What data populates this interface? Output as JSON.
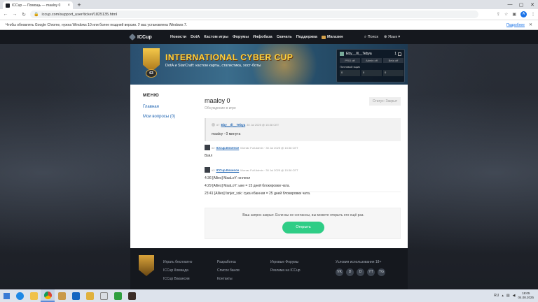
{
  "browser": {
    "tab_title": "ICCup — Помощь — maaloy 0",
    "url": "iccup.com/support_user/ticket/1825135.html",
    "avatar_letter": "A",
    "info_message": "Чтобы обновлять Google Chrome, нужна Windows 10 или более поздней версии. У вас установлена Windows 7.",
    "info_more": "Подробнее"
  },
  "site": {
    "logo": "ICCup",
    "menu": [
      "Новости",
      "DotA",
      "Кастом игры",
      "Форумы",
      "Инфобаза",
      "Скачать",
      "Поддержка",
      "Магазин"
    ],
    "search_label": "Поиск",
    "lang_label": "Язык",
    "banner": {
      "level": "63",
      "title": "INTERNATIONAL CYBER CUP",
      "subtitle": "DotA и StarCraft: кастом карты, статистика, хост-боты"
    },
    "user_panel": {
      "name": "Eby__Ill__Tebya",
      "count": "1",
      "tags": [
        "PRO off",
        "Admin off",
        "Beta off"
      ],
      "mail_label": "Почтовый ящик",
      "counts": [
        "0",
        "0",
        "0"
      ]
    }
  },
  "sidebar": {
    "title": "МЕНЮ",
    "items": [
      "Главная",
      "Мои вопросы (0)"
    ]
  },
  "ticket": {
    "title": "maaloy 0",
    "subtitle": "Обсуждение в игре",
    "status": "Статус: Закрыт",
    "question": {
      "num": "#7",
      "author": "Eby__Ill__Tebya",
      "date": "30 Jul 2025 @ 15:38 CET",
      "text": "maaloy - 0 минута"
    },
    "answers": [
      {
        "num": "#2",
        "author": "ICCup.Essence",
        "meta": "Мотив: Full Admin · 30 Jul 2025 @ 15:38 CET",
        "lines": [
          "Взял"
        ]
      },
      {
        "num": "#3",
        "author": "ICCup.Essence",
        "meta": "Мотив: Full Admin · 30 Jul 2025 @ 15:38 CET",
        "lines": [
          "4:36 [Allies] MaaLoY: онлеол",
          "4:29 [Allies] MaaLoY: ыке = 15 дней блокировки чата.",
          "23:41 [Allies] fanjer_ssk: сука ебанная = 25 дней блокировки чата."
        ]
      }
    ],
    "closed_text": "Ваш запрос закрыт. Если вы не согласны, вы можете открыть его ещё раз.",
    "open_button": "Открыть"
  },
  "footer": {
    "col1": [
      "Играть бесплатно",
      "ICCup Команда",
      "ICCup Вакансии"
    ],
    "col2": [
      "Разработка",
      "Список банов",
      "Контакты"
    ],
    "col3": [
      "Игровые Форумы",
      "Реклама на ICCup"
    ],
    "social_title": "Условия использования 18+",
    "social": [
      "VK",
      "D",
      "D",
      "YT",
      "TG"
    ]
  },
  "taskbar": {
    "lang": "RU",
    "time": "18:05",
    "date": "04.08.2025"
  }
}
